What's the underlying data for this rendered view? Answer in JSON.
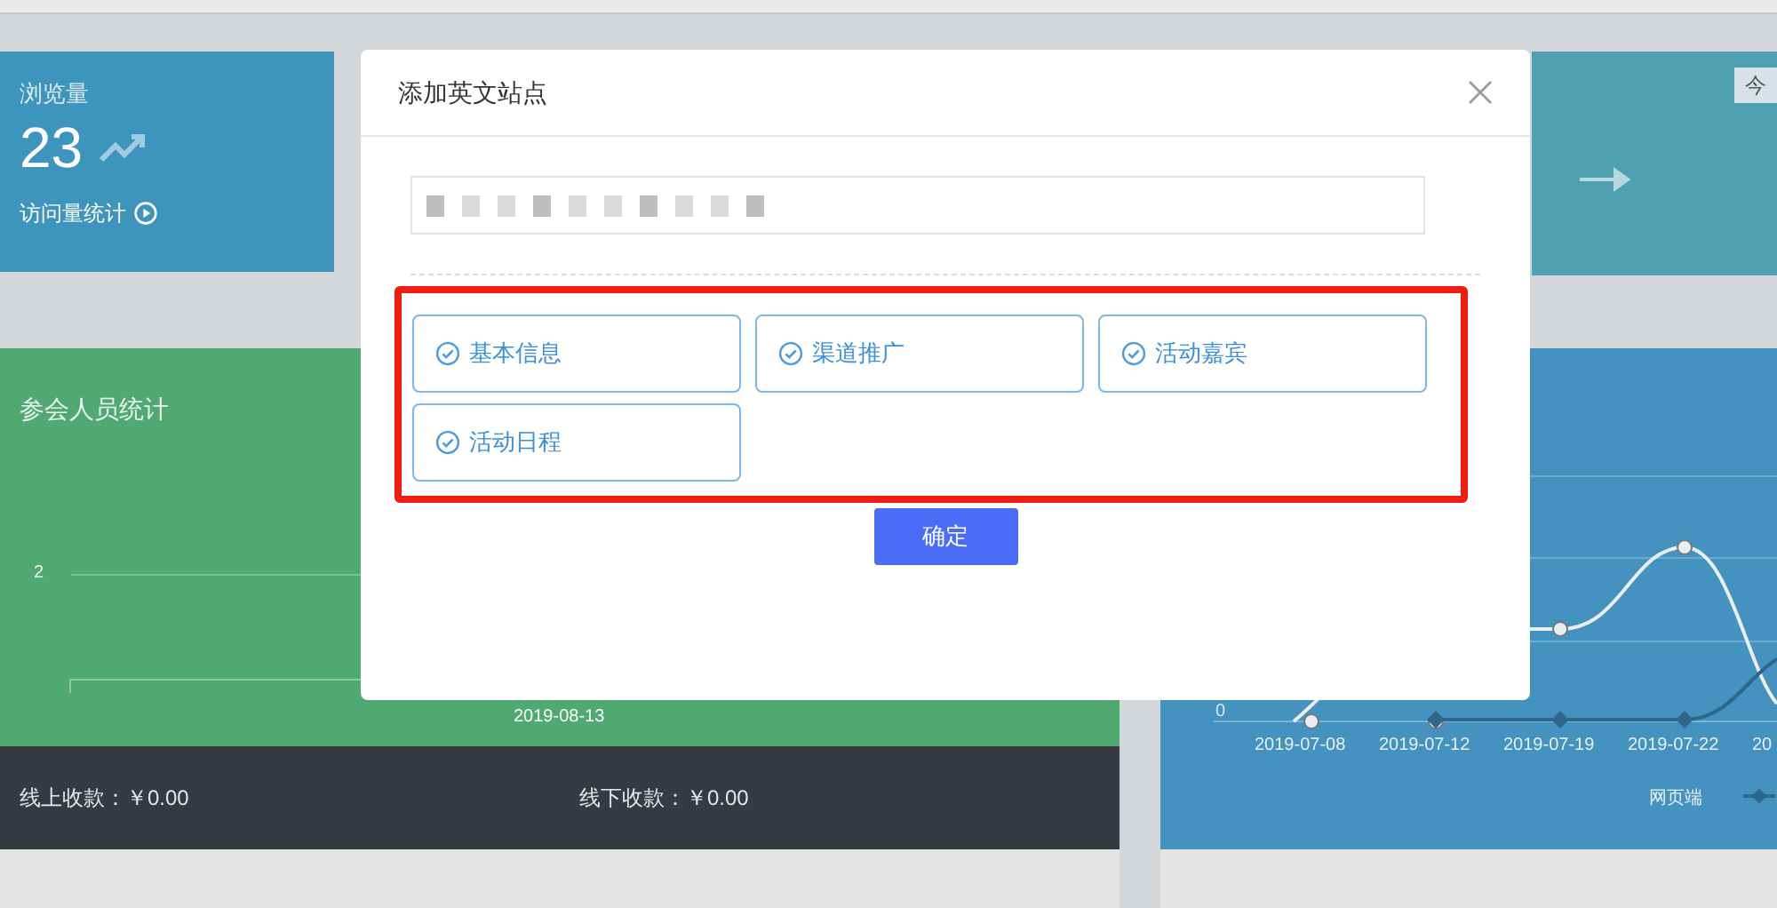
{
  "views_card": {
    "label": "浏览量",
    "value": "23",
    "link": "访问量统计"
  },
  "today_card": {
    "tag": "今"
  },
  "attendee_panel": {
    "title": "参会人员统计",
    "ytick": "2",
    "xlabel": "2019-08-13"
  },
  "payments": [
    {
      "text": "线上收款：￥0.00"
    },
    {
      "text": "线下收款：￥0.00"
    }
  ],
  "traffic_chart": {
    "ytick": "0",
    "dates": [
      "2019-07-08",
      "2019-07-12",
      "2019-07-19",
      "2019-07-22",
      "20"
    ],
    "legend": "网页端"
  },
  "dialog": {
    "title": "添加英文站点",
    "options": [
      {
        "label": "基本信息",
        "checked": true
      },
      {
        "label": "渠道推广",
        "checked": true
      },
      {
        "label": "活动嘉宾",
        "checked": true
      },
      {
        "label": "活动日程",
        "checked": true
      }
    ],
    "confirm": "确定"
  }
}
